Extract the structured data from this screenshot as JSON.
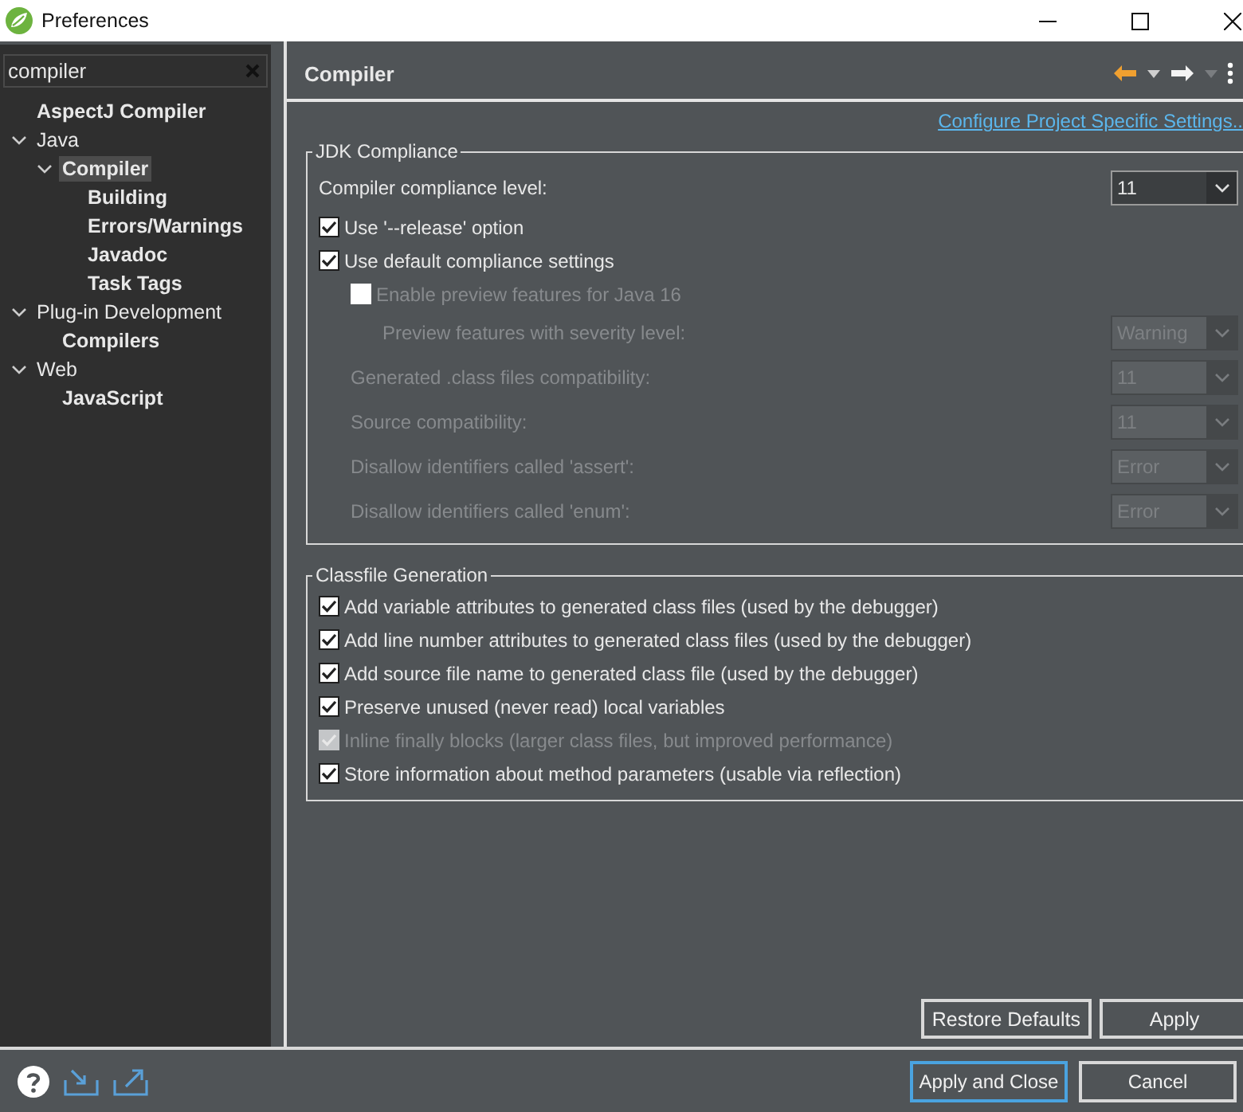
{
  "window": {
    "title": "Preferences"
  },
  "filter": {
    "value": "compiler"
  },
  "tree": [
    {
      "label": "AspectJ Compiler",
      "match": true,
      "selected": false
    },
    {
      "label": "Java",
      "match": false,
      "selected": false,
      "expanded": true,
      "children": [
        {
          "label": "Compiler",
          "match": true,
          "selected": true,
          "expanded": true,
          "children": [
            {
              "label": "Building",
              "match": true,
              "selected": false
            },
            {
              "label": "Errors/Warnings",
              "match": true,
              "selected": false
            },
            {
              "label": "Javadoc",
              "match": true,
              "selected": false
            },
            {
              "label": "Task Tags",
              "match": true,
              "selected": false
            }
          ]
        }
      ]
    },
    {
      "label": "Plug-in Development",
      "match": false,
      "selected": false,
      "expanded": true,
      "children": [
        {
          "label": "Compilers",
          "match": true,
          "selected": false
        }
      ]
    },
    {
      "label": "Web",
      "match": false,
      "selected": false,
      "expanded": true,
      "children": [
        {
          "label": "JavaScript",
          "match": true,
          "selected": false
        }
      ]
    }
  ],
  "page": {
    "title": "Compiler",
    "link": "Configure Project Specific Settings..",
    "groups": [
      {
        "title": "JDK Compliance",
        "rows": [
          {
            "kind": "combo",
            "label": "Compiler compliance level:",
            "value": "11",
            "disabled": false
          },
          {
            "kind": "checkbox",
            "label": "Use '--release' option",
            "checked": true,
            "disabled": false
          },
          {
            "kind": "checkbox",
            "label": "Use default compliance settings",
            "checked": true,
            "disabled": false,
            "children": [
              {
                "kind": "checkbox",
                "label": "Enable preview features for Java 16",
                "checked": false,
                "disabled": true,
                "children": [
                  {
                    "kind": "combo",
                    "label": "Preview features with severity level:",
                    "value": "Warning",
                    "disabled": true
                  }
                ]
              },
              {
                "kind": "combo",
                "label": "Generated .class files compatibility:",
                "value": "11",
                "disabled": true
              },
              {
                "kind": "combo",
                "label": "Source compatibility:",
                "value": "11",
                "disabled": true
              },
              {
                "kind": "combo",
                "label": "Disallow identifiers called 'assert':",
                "value": "Error",
                "disabled": true
              },
              {
                "kind": "combo",
                "label": "Disallow identifiers called 'enum':",
                "value": "Error",
                "disabled": true
              }
            ]
          }
        ]
      },
      {
        "title": "Classfile Generation",
        "rows": [
          {
            "kind": "checkbox",
            "label": "Add variable attributes to generated class files (used by the debugger)",
            "checked": true,
            "disabled": false
          },
          {
            "kind": "checkbox",
            "label": "Add line number attributes to generated class files (used by the debugger)",
            "checked": true,
            "disabled": false
          },
          {
            "kind": "checkbox",
            "label": "Add source file name to generated class file (used by the debugger)",
            "checked": true,
            "disabled": false
          },
          {
            "kind": "checkbox",
            "label": "Preserve unused (never read) local variables",
            "checked": true,
            "disabled": false
          },
          {
            "kind": "checkbox",
            "label": "Inline finally blocks (larger class files, but improved performance)",
            "checked": true,
            "disabled": true
          },
          {
            "kind": "checkbox",
            "label": "Store information about method parameters (usable via reflection)",
            "checked": true,
            "disabled": false
          }
        ]
      }
    ],
    "buttons": [
      {
        "label": "Restore Defaults"
      },
      {
        "label": "Apply"
      }
    ]
  },
  "footer_buttons": [
    {
      "label": "Apply and Close",
      "default": true
    },
    {
      "label": "Cancel",
      "default": false
    }
  ]
}
